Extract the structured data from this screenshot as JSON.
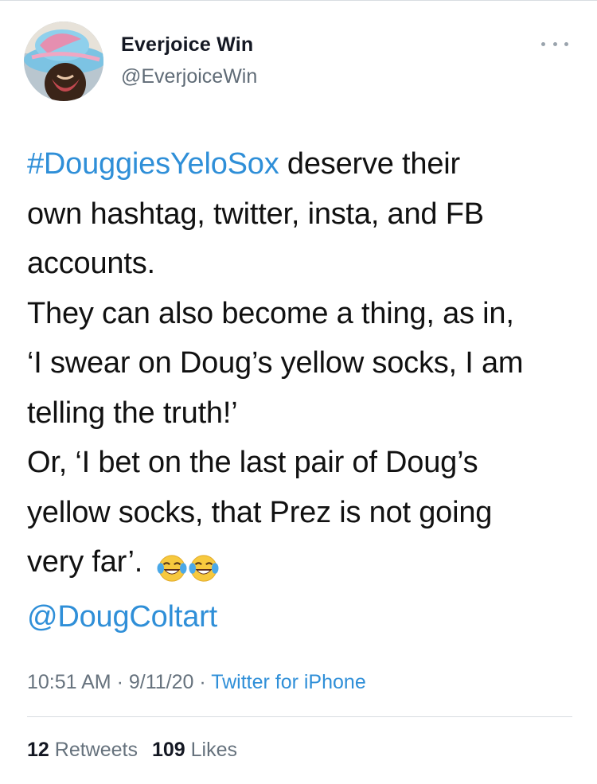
{
  "author": {
    "display_name": "Everjoice Win",
    "handle": "@EverjoiceWin"
  },
  "tweet": {
    "hashtag": "#DouggiesYeloSox",
    "line1_rest": " deserve their",
    "line2": "own hashtag, twitter, insta, and FB",
    "line3": "accounts.",
    "line4": "They can also become a thing, as in,",
    "line5": "‘I swear on Doug’s yellow socks, I am",
    "line6": "telling the truth!’",
    "line7": "Or, ‘I bet on the last pair of Doug’s",
    "line8": "yellow socks, that Prez is not going",
    "line9": "very far’.",
    "emojis": [
      "face-with-tears-of-joy-icon",
      "face-with-tears-of-joy-icon"
    ],
    "mention": "@DougColtart"
  },
  "meta": {
    "time": "10:51 AM",
    "sep1": " · ",
    "date": "9/11/20",
    "sep2": " · ",
    "source": "Twitter for iPhone"
  },
  "stats": {
    "retweets_count": "12",
    "retweets_label": "Retweets",
    "likes_count": "109",
    "likes_label": "Likes"
  },
  "colors": {
    "link": "#2f8fd8",
    "text": "#111111",
    "secondary": "#66727d"
  }
}
